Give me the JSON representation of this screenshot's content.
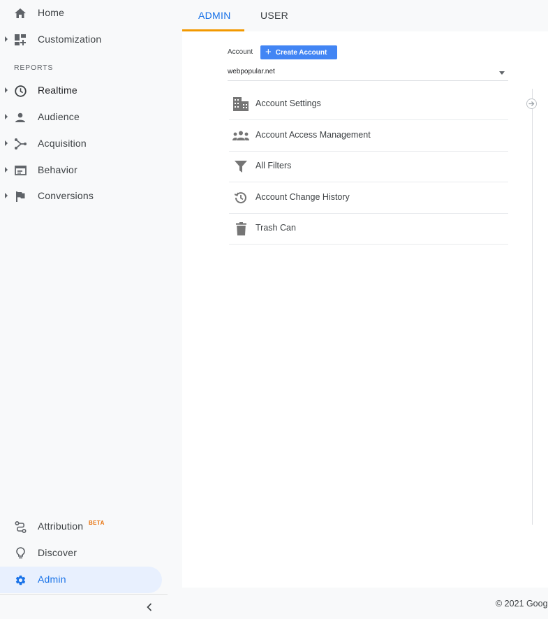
{
  "sidebar": {
    "items_top": [
      {
        "label": "Home",
        "icon": "home-icon"
      },
      {
        "label": "Customization",
        "icon": "dashboard-icon"
      }
    ],
    "section_title": "REPORTS",
    "reports": [
      {
        "label": "Realtime",
        "icon": "clock-icon"
      },
      {
        "label": "Audience",
        "icon": "person-icon"
      },
      {
        "label": "Acquisition",
        "icon": "acquisition-icon"
      },
      {
        "label": "Behavior",
        "icon": "behavior-icon"
      },
      {
        "label": "Conversions",
        "icon": "flag-icon"
      }
    ],
    "items_bottom": [
      {
        "label": "Attribution",
        "icon": "attribution-icon",
        "badge": "BETA"
      },
      {
        "label": "Discover",
        "icon": "lightbulb-icon"
      },
      {
        "label": "Admin",
        "icon": "gear-icon"
      }
    ],
    "collapse_glyph": "‹"
  },
  "tabs": [
    {
      "label": "ADMIN",
      "active": true
    },
    {
      "label": "USER",
      "active": false
    }
  ],
  "account": {
    "label": "Account",
    "create_button": "Create Account",
    "selected": "webpopular.net"
  },
  "menu": [
    {
      "label": "Account Settings",
      "icon": "building-icon"
    },
    {
      "label": "Account Access Management",
      "icon": "people-icon"
    },
    {
      "label": "All Filters",
      "icon": "filter-icon"
    },
    {
      "label": "Account Change History",
      "icon": "history-icon"
    },
    {
      "label": "Trash Can",
      "icon": "trash-icon"
    }
  ],
  "footer": "© 2021 Goog",
  "colors": {
    "accent": "#1a73e8",
    "tab_indicator": "#f29900",
    "create_button": "#4285f4",
    "beta_badge": "#e8710a",
    "active_nav_bg": "#e8f0fe"
  }
}
